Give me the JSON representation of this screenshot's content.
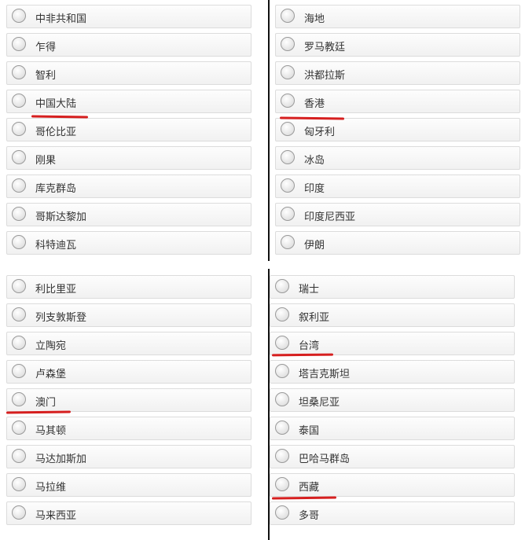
{
  "accent_color": "#d61f1f",
  "columns": [
    {
      "items": [
        "中非共和国",
        "乍得",
        "智利",
        "中国大陆",
        "哥伦比亚",
        "刚果",
        "库克群岛",
        "哥斯达黎加",
        "科特迪瓦"
      ],
      "highlighted": [
        "中国大陆"
      ]
    },
    {
      "items": [
        "海地",
        "罗马教廷",
        "洪都拉斯",
        "香港",
        "匈牙利",
        "冰岛",
        "印度",
        "印度尼西亚",
        "伊朗"
      ],
      "highlighted": [
        "香港"
      ]
    },
    {
      "items": [
        "利比里亚",
        "列支敦斯登",
        "立陶宛",
        "卢森堡",
        "澳门",
        "马其顿",
        "马达加斯加",
        "马拉维",
        "马来西亚"
      ],
      "highlighted": [
        "澳门"
      ]
    },
    {
      "items": [
        "瑞士",
        "叙利亚",
        "台湾",
        "塔吉克斯坦",
        "坦桑尼亚",
        "泰国",
        "巴哈马群岛",
        "西藏",
        "多哥"
      ],
      "highlighted": [
        "台湾",
        "西藏"
      ]
    }
  ]
}
